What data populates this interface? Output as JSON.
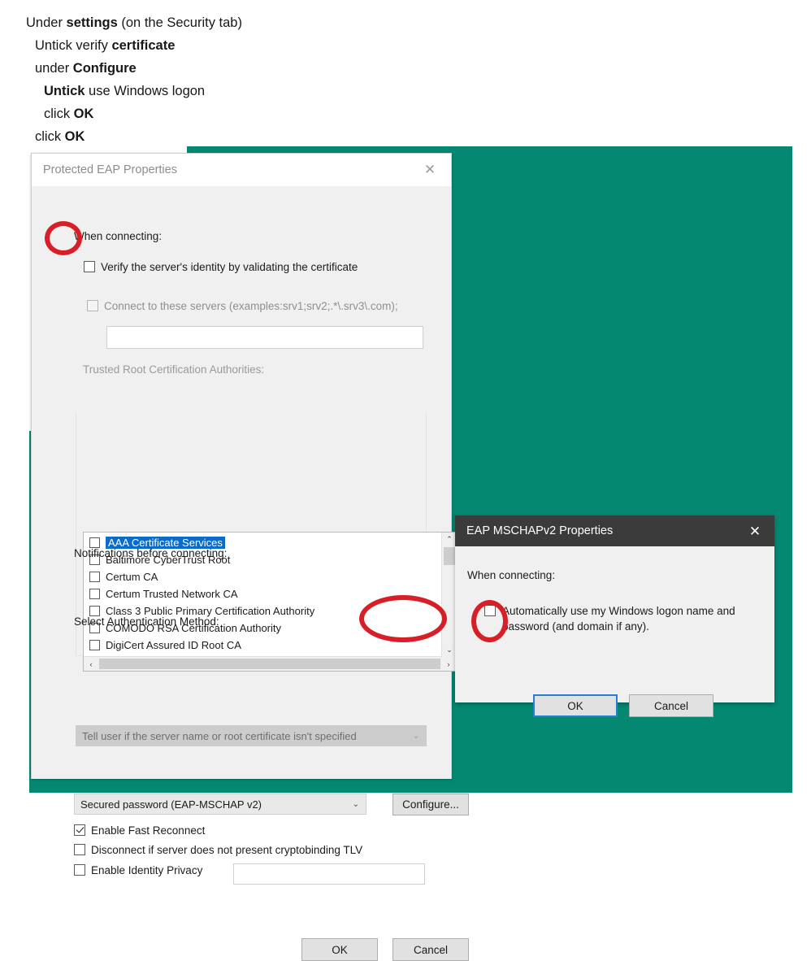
{
  "instructions": {
    "lines": [
      {
        "indent": 0,
        "parts": [
          {
            "t": "Under ",
            "b": false
          },
          {
            "t": "settings",
            "b": true
          },
          {
            "t": " (on the Security tab)",
            "b": false
          }
        ]
      },
      {
        "indent": 1,
        "parts": [
          {
            "t": "Untick verify ",
            "b": false
          },
          {
            "t": "certificate",
            "b": true
          }
        ]
      },
      {
        "indent": 1,
        "parts": [
          {
            "t": "under ",
            "b": false
          },
          {
            "t": "Configure",
            "b": true
          }
        ]
      },
      {
        "indent": 2,
        "parts": [
          {
            "t": "Untick",
            "b": true
          },
          {
            "t": " use Windows logon",
            "b": false
          }
        ]
      },
      {
        "indent": 2,
        "parts": [
          {
            "t": "click ",
            "b": false
          },
          {
            "t": "OK",
            "b": true
          }
        ]
      },
      {
        "indent": 1,
        "parts": [
          {
            "t": "click ",
            "b": false
          },
          {
            "t": "OK",
            "b": true
          }
        ]
      }
    ]
  },
  "colors": {
    "desktop_teal": "#048872",
    "annotation_red": "#d81f28",
    "selection_blue": "#0a6bc9",
    "focus_blue": "#2a7fd4"
  },
  "eap_dialog": {
    "title": "Protected EAP Properties",
    "close_icon": "✕",
    "when_connecting_label": "When connecting:",
    "verify_certificate": {
      "label": "Verify the server's identity by validating the certificate",
      "checked": false
    },
    "connect_servers": {
      "label": "Connect to these servers (examples:srv1;srv2;.*\\.srv3\\.com);",
      "checked": false,
      "value": ""
    },
    "trusted_roots_label": "Trusted Root Certification Authorities:",
    "trusted_roots": [
      {
        "name": "AAA Certificate Services",
        "checked": false,
        "selected": true
      },
      {
        "name": "Baltimore CyberTrust Root",
        "checked": false,
        "selected": false
      },
      {
        "name": "Certum CA",
        "checked": false,
        "selected": false
      },
      {
        "name": "Certum Trusted Network CA",
        "checked": false,
        "selected": false
      },
      {
        "name": "Class 3 Public Primary Certification Authority",
        "checked": false,
        "selected": false
      },
      {
        "name": "COMODO RSA Certification Authority",
        "checked": false,
        "selected": false
      },
      {
        "name": "DigiCert Assured ID Root CA",
        "checked": false,
        "selected": false
      }
    ],
    "scroll_up_icon": "⌃",
    "scroll_down_icon": "⌄",
    "scroll_left_icon": "‹",
    "scroll_right_icon": "›",
    "notifications_label": "Notifications before connecting:",
    "notifications_value": "Tell user if the server name or root certificate isn't specified",
    "auth_method_label": "Select Authentication Method:",
    "auth_method_value": "Secured password (EAP-MSCHAP v2)",
    "caret_icon": "⌄",
    "configure_button": "Configure...",
    "options": [
      {
        "label": "Enable Fast Reconnect",
        "checked": true
      },
      {
        "label": "Disconnect if server does not present cryptobinding TLV",
        "checked": false
      },
      {
        "label": "Enable Identity Privacy",
        "checked": false
      }
    ],
    "identity_privacy_value": "",
    "ok_button": "OK",
    "cancel_button": "Cancel"
  },
  "mschap_dialog": {
    "title": "EAP MSCHAPv2 Properties",
    "close_icon": "✕",
    "when_connecting_label": "When connecting:",
    "auto_logon": {
      "label": "Automatically use my Windows logon name and password (and domain if any).",
      "checked": false
    },
    "ok_button": "OK",
    "cancel_button": "Cancel"
  }
}
